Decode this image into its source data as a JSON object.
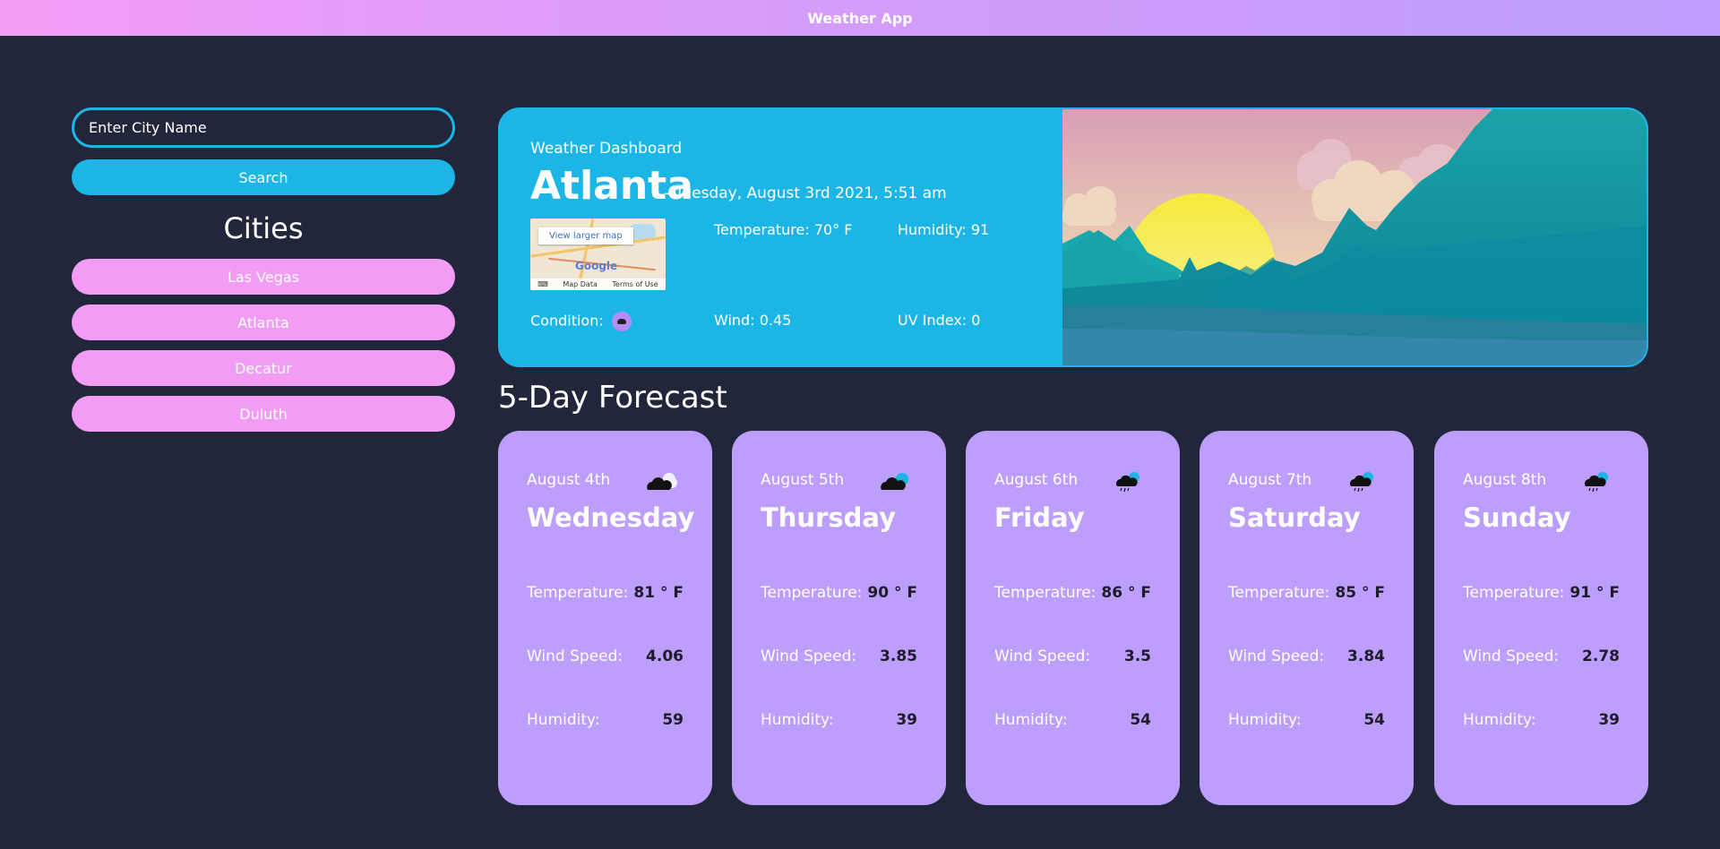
{
  "app": {
    "title": "Weather App"
  },
  "sidebar": {
    "search_placeholder": "Enter City Name",
    "search_label": "Search",
    "cities_title": "Cities",
    "cities": [
      "Las Vegas",
      "Atlanta",
      "Decatur",
      "Duluth"
    ]
  },
  "current": {
    "dashboard_label": "Weather Dashboard",
    "city": "Atlanta",
    "date": "- Tuesday, August 3rd 2021, 5:51 am",
    "temperature": "Temperature: 70° F",
    "humidity": "Humidity: 91",
    "condition_label": "Condition:",
    "condition_icon": "cloud-icon",
    "wind": "Wind: 0.45",
    "uv": "UV Index: 0",
    "map": {
      "link": "View larger map",
      "brand": "Google",
      "map_data": "Map Data",
      "terms": "Terms of Use"
    }
  },
  "forecast": {
    "title": "5-Day Forecast",
    "labels": {
      "temperature": "Temperature:",
      "wind": "Wind Speed:",
      "humidity": "Humidity:"
    },
    "days": [
      {
        "date": "August 4th",
        "day": "Wednesday",
        "temp": "81 ° F",
        "wind": "4.06",
        "humidity": "59",
        "icon": "cloud-sun-icon"
      },
      {
        "date": "August 5th",
        "day": "Thursday",
        "temp": "90 ° F",
        "wind": "3.85",
        "humidity": "39",
        "icon": "cloud-sun-icon"
      },
      {
        "date": "August 6th",
        "day": "Friday",
        "temp": "86 ° F",
        "wind": "3.5",
        "humidity": "54",
        "icon": "cloud-rain-sun-icon"
      },
      {
        "date": "August 7th",
        "day": "Saturday",
        "temp": "85 ° F",
        "wind": "3.84",
        "humidity": "54",
        "icon": "cloud-rain-sun-icon"
      },
      {
        "date": "August 8th",
        "day": "Sunday",
        "temp": "91 ° F",
        "wind": "2.78",
        "humidity": "39",
        "icon": "cloud-rain-sun-icon"
      }
    ]
  },
  "colors": {
    "background": "#21263a",
    "accent_blue": "#1cb6e6",
    "city_pink": "#f29cf5",
    "card_purple": "#bd9efc"
  }
}
